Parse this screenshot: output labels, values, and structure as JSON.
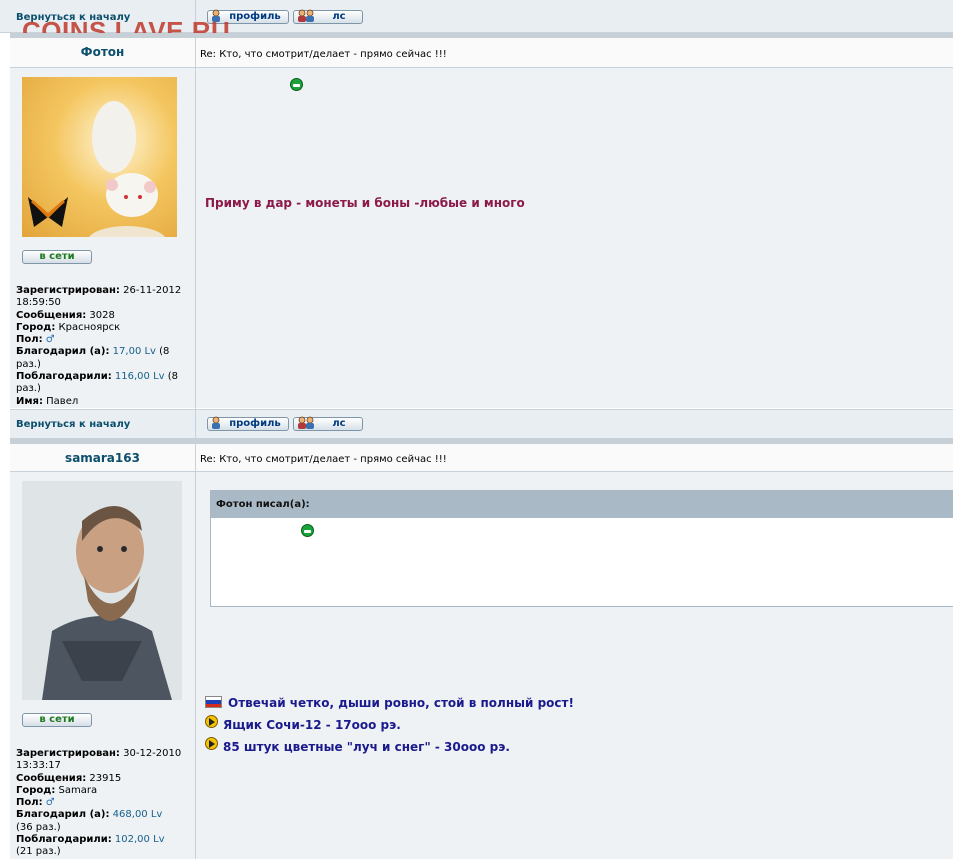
{
  "watermark": "COINS.LAVE.RU",
  "nav": {
    "back_to_top": "Вернуться к началу",
    "profile_label": "профиль",
    "pm_label": "лс"
  },
  "posts": [
    {
      "author": "Фотон",
      "subject": "Re: Кто, что смотрит/делает - прямо сейчас !!!",
      "online_label": "в сети",
      "body_text": "Приму в дар - монеты и боны -любые и много",
      "info": {
        "registered_label": "Зарегистрирован:",
        "registered_value": "26-11-2012",
        "registered_time": "18:59:50",
        "messages_label": "Сообщения:",
        "messages_value": "3028",
        "city_label": "Город:",
        "city_value": "Красноярск",
        "gender_label": "Пол:",
        "thanked_label": "Благодарил (а):",
        "thanked_value": "17,00 Lv",
        "thanked_count": "(8",
        "thanked_count_2": "раз.)",
        "was_thanked_label": "Поблагодарили:",
        "was_thanked_value": "116,00 Lv",
        "was_thanked_count": "(8",
        "was_thanked_count_2": "раз.)",
        "name_label": "Имя:",
        "name_value": "Павел"
      }
    },
    {
      "author": "samara163",
      "subject": "Re: Кто, что смотрит/делает - прямо сейчас !!!",
      "online_label": "в сети",
      "quote_header": "Фотон писал(а):",
      "signature": [
        "Отвечай четко, дыши ровно, стой в полный рост!",
        "Ящик Сочи-12 - 17ооо рэ.",
        "85 штук цветные \"луч и снег\" - 30ооо рэ."
      ],
      "info": {
        "registered_label": "Зарегистрирован:",
        "registered_value": "30-12-2010",
        "registered_time": "13:33:17",
        "messages_label": "Сообщения:",
        "messages_value": "23915",
        "city_label": "Город:",
        "city_value": "Samara",
        "gender_label": "Пол:",
        "thanked_label": "Благодарил (а):",
        "thanked_value": "468,00 Lv",
        "thanked_count": "(36 раз.)",
        "was_thanked_label": "Поблагодарили:",
        "was_thanked_value": "102,00 Lv",
        "was_thanked_count": "(21 раз.)"
      }
    }
  ],
  "colors": {
    "row_light": "#e9eef2",
    "link": "#0b4f6c",
    "body_text": "#8b1a4a",
    "signature": "#1a1a8c",
    "watermark": "#c0392b"
  }
}
